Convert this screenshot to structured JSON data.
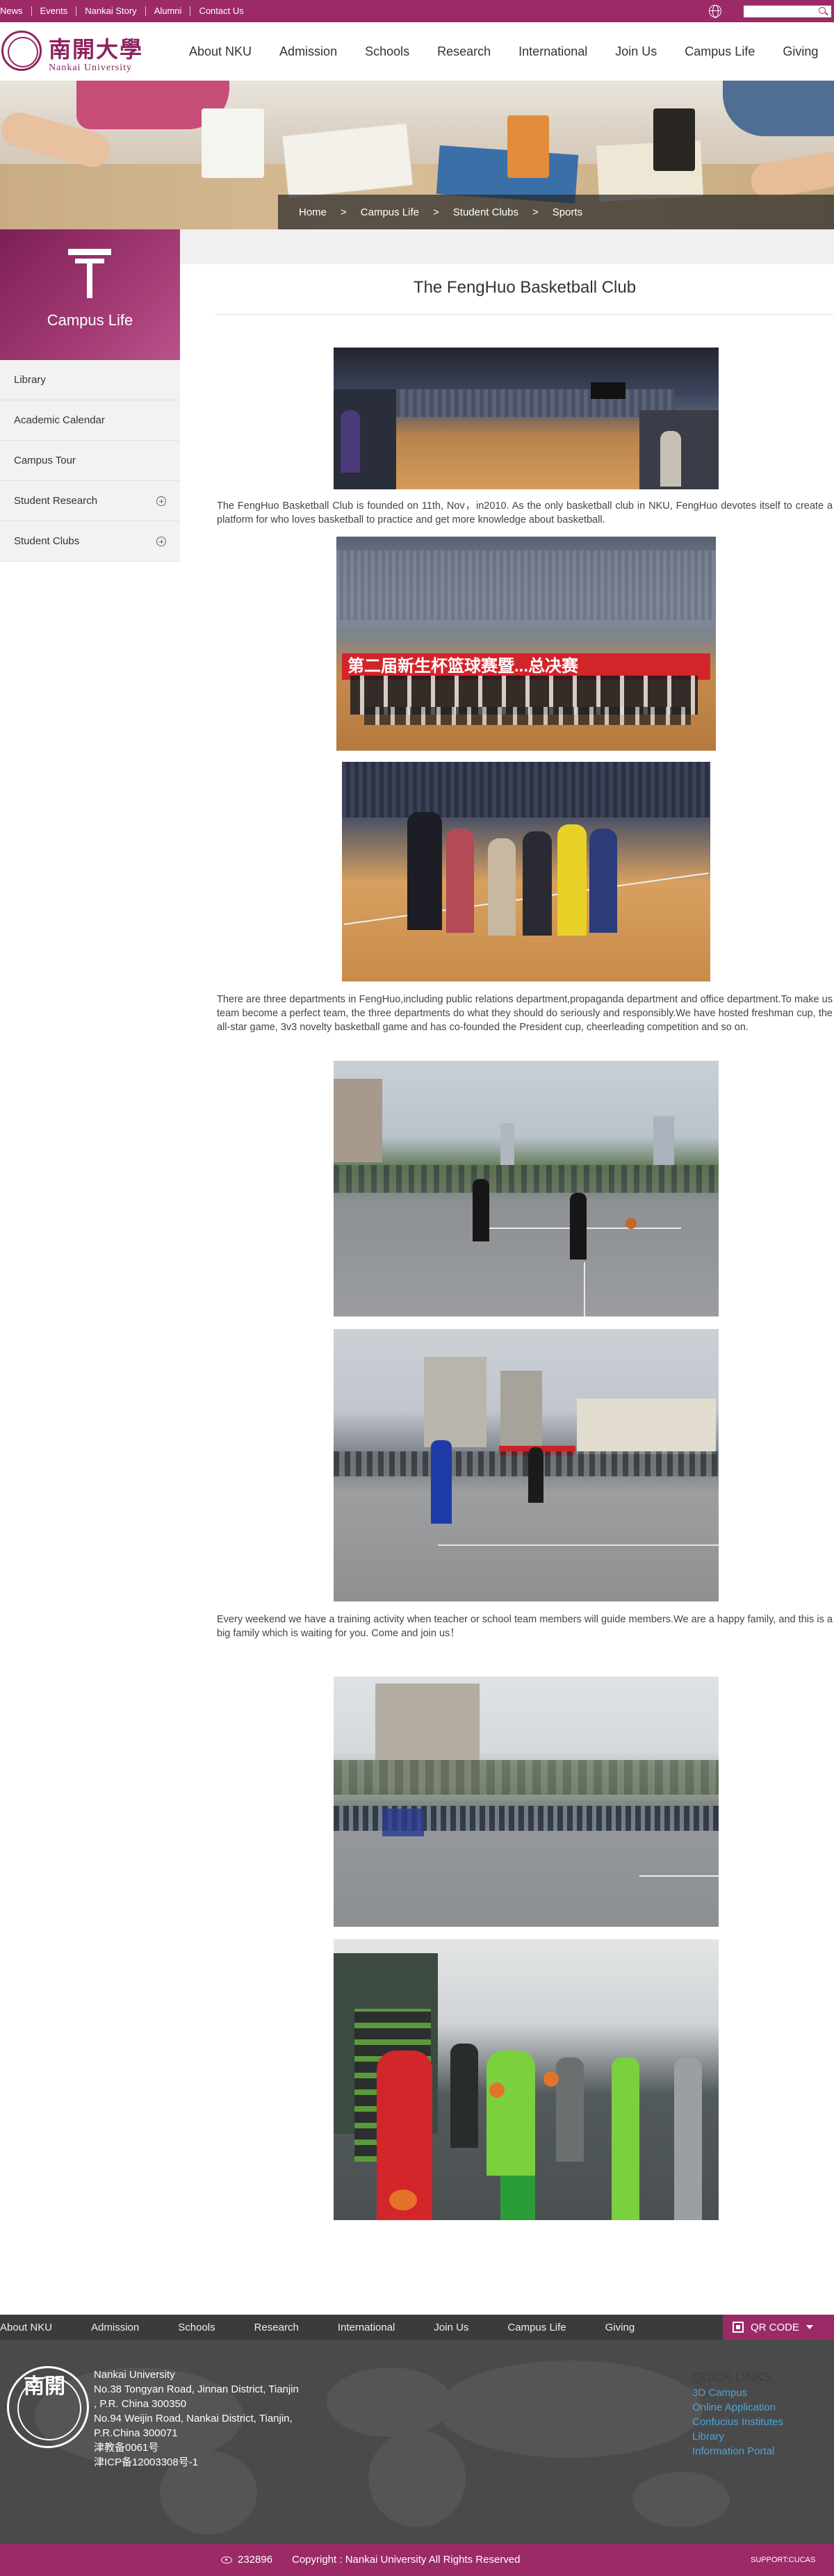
{
  "top_links": [
    "News",
    "Events",
    "Nankai Story",
    "Alumni",
    "Contact Us"
  ],
  "search": {
    "placeholder": ""
  },
  "logo": {
    "cn": "南開大學",
    "en": "Nankai University"
  },
  "main_nav": [
    "About NKU",
    "Admission",
    "Schools",
    "Research",
    "International",
    "Join Us",
    "Campus Life",
    "Giving"
  ],
  "breadcrumb": [
    "Home",
    "Campus Life",
    "Student Clubs",
    "Sports"
  ],
  "breadcrumb_sep": ">",
  "sidebar": {
    "title": "Campus Life",
    "items": [
      {
        "label": "Library"
      },
      {
        "label": "Academic Calendar"
      },
      {
        "label": "Campus Tour"
      },
      {
        "label": "Student Research"
      },
      {
        "label": "Student Clubs"
      }
    ]
  },
  "article": {
    "title": "The FengHuo Basketball Club",
    "para1": "The FengHuo Basketball Club is founded on 11th, Nov，in2010. As the only basketball club in NKU, FengHuo devotes itself to create a platform for who loves basketball to practice and get more knowledge about basketball.",
    "para2": "There are three departments in FengHuo,including public relations department,propaganda department and office department.To make us team become a perfect team, the three departments do what they should do seriously and responsibly.We have hosted freshman cup, the all-star game, 3v3 novelty basketball game and has co-founded the President cup, cheerleading competition and so on.",
    "para3": "Every weekend we have a training activity when teacher or school team members will guide members.We are a happy family, and this is a big family which is waiting for you. Come and join us！",
    "banner_text": "第二届新生杯篮球赛暨...总决赛"
  },
  "footer_nav": [
    "About NKU",
    "Admission",
    "Schools",
    "Research",
    "International",
    "Join Us",
    "Campus Life",
    "Giving"
  ],
  "qr_label": "QR CODE",
  "footer": {
    "seal_text": "南開",
    "address": [
      "Nankai University",
      "No.38 Tongyan Road, Jinnan District, Tianjin",
      ", P.R. China 300350",
      "No.94 Weijin Road,  Nankai District, Tianjin,",
      "P.R.China  300071",
      "津教备0061号",
      "津ICP备12003308号-1"
    ],
    "quick_title": "QUICK LINKS",
    "quick_links": [
      "3D Campus",
      "Online Application",
      "Confucius Institutes",
      "Library",
      "Information Portal"
    ]
  },
  "footbar": {
    "visits": "232896",
    "copyright": "Copyright : Nankai University All Rights Reserved",
    "support": "SUPPORT:CUCAS"
  },
  "colors": {
    "brand": "#9c2a67",
    "link": "#4ea3d9"
  }
}
